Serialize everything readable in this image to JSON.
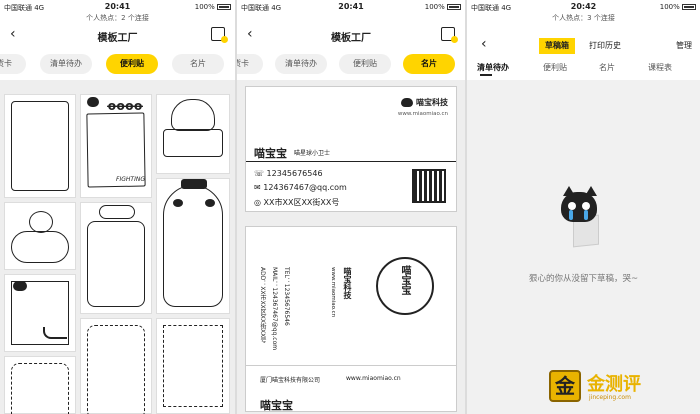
{
  "screens": [
    {
      "status": {
        "carrier": "中国联通 4G",
        "time": "20:41",
        "battery": "100%",
        "hotspot": "个人热点：2 个连接"
      },
      "nav": {
        "title": "模板工厂"
      },
      "tabs": [
        "换货卡",
        "清单待办",
        "便利贴",
        "名片"
      ],
      "active_tab": "便利贴",
      "notes": [
        "FIGHTING"
      ]
    },
    {
      "status": {
        "carrier": "中国联通 4G",
        "time": "20:41",
        "battery": "100%",
        "hotspot": ""
      },
      "nav": {
        "title": "模板工厂"
      },
      "tabs": [
        "换货卡",
        "清单待办",
        "便利贴",
        "名片"
      ],
      "active_tab": "名片",
      "card_front": {
        "company": "喵宝科技",
        "url": "www.miaomiao.cn",
        "name": "喵宝宝",
        "subtitle": "喵星球小卫士",
        "phone": "12345676546",
        "email": "124367467@qq.com",
        "address": "XX市XX区XX街XX号"
      },
      "card_back": {
        "circle_name": "喵宝宝",
        "company": "喵宝科技",
        "url": "www.miaomiao.cn",
        "tel": "TEL：12345676546",
        "mail": "MAIL：124367467@qq.com",
        "add": "ADD：XX市XX区XX街XX号",
        "footer_company": "厦门喵宝科技有限公司",
        "footer_url": "www.miaomiao.cn",
        "partial_name": "喵宝宝"
      }
    },
    {
      "status": {
        "carrier": "中国联通 4G",
        "time": "20:42",
        "battery": "100%",
        "hotspot": "个人热点：3 个连接"
      },
      "segments": [
        "草稿箱",
        "打印历史"
      ],
      "active_segment": "草稿箱",
      "manage": "管理",
      "subtabs": [
        "清单待办",
        "便利贴",
        "名片",
        "课程表"
      ],
      "active_subtab": "清单待办",
      "empty_text": "狠心的你从没留下草稿，哭~",
      "watermark": {
        "brand": "金测评",
        "site": "jinceping.com"
      }
    }
  ],
  "colors": {
    "accent": "#ffd400",
    "canvas": "#eeeeee",
    "text": "#222222"
  }
}
